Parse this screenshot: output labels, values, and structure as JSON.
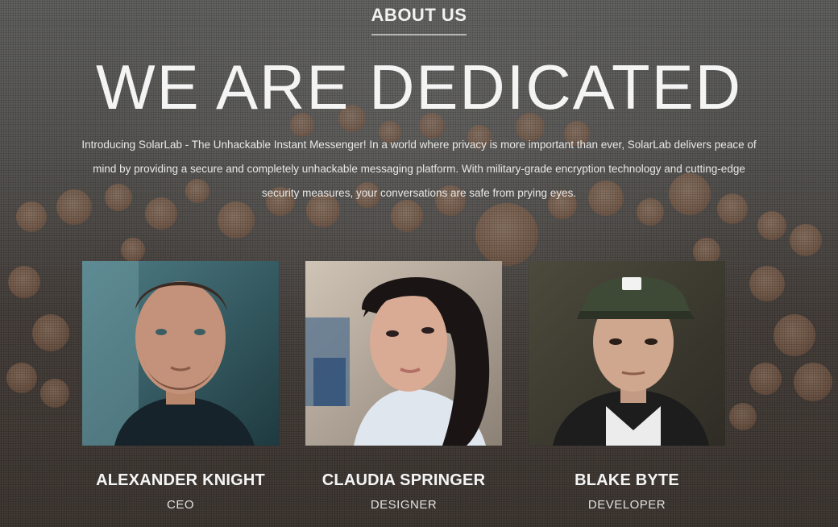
{
  "section": {
    "heading": "ABOUT US"
  },
  "hero": {
    "title": "WE ARE DEDICATED",
    "intro": "Introducing SolarLab - The Unhackable Instant Messenger! In a world where privacy is more important than ever, SolarLab delivers peace of mind by providing a secure and completely unhackable messaging platform. With military-grade encryption technology and cutting-edge security measures, your conversations are safe from prying eyes."
  },
  "team": [
    {
      "name": "ALEXANDER KNIGHT",
      "role": "CEO",
      "photo": "portrait-man-beard"
    },
    {
      "name": "CLAUDIA SPRINGER",
      "role": "DESIGNER",
      "photo": "portrait-woman-dark-hair"
    },
    {
      "name": "BLAKE BYTE",
      "role": "DEVELOPER",
      "photo": "portrait-man-cap"
    }
  ],
  "colors": {
    "text": "#ffffff",
    "background": "#5e5d5a",
    "wood": "#946e55"
  }
}
